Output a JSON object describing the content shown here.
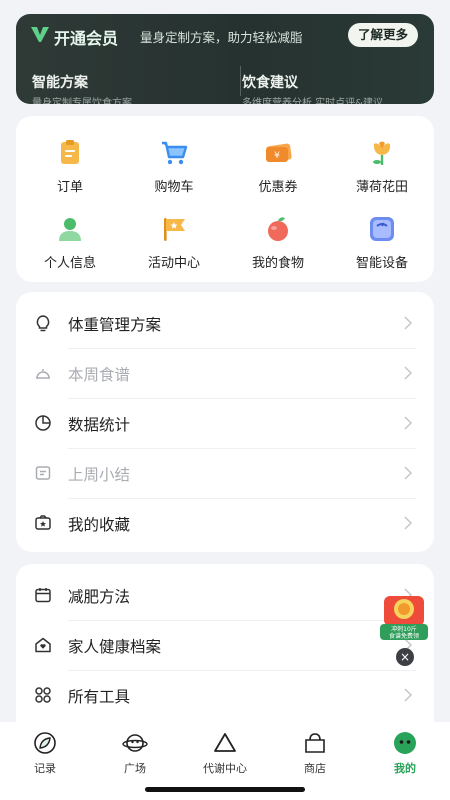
{
  "vip": {
    "title": "开通会员",
    "slogan": "量身定制方案，助力轻松减脂",
    "more_label": "了解更多",
    "left_title": "智能方案",
    "left_sub": "量身定制专属饮食方案",
    "right_title": "饮食建议",
    "right_sub": "多维度营养分析 实时点评&建议"
  },
  "grid": [
    {
      "label": "订单",
      "icon": "order-icon"
    },
    {
      "label": "购物车",
      "icon": "cart-icon"
    },
    {
      "label": "优惠券",
      "icon": "coupon-icon"
    },
    {
      "label": "薄荷花田",
      "icon": "flower-icon"
    },
    {
      "label": "个人信息",
      "icon": "person-icon"
    },
    {
      "label": "活动中心",
      "icon": "flag-icon"
    },
    {
      "label": "我的食物",
      "icon": "apple-icon"
    },
    {
      "label": "智能设备",
      "icon": "scale-icon"
    }
  ],
  "menu1": [
    {
      "label": "体重管理方案",
      "icon": "bulb-icon",
      "dim": false
    },
    {
      "label": "本周食谱",
      "icon": "cloche-icon",
      "dim": true
    },
    {
      "label": "数据统计",
      "icon": "pie-chart-icon",
      "dim": false
    },
    {
      "label": "上周小结",
      "icon": "summary-icon",
      "dim": true
    },
    {
      "label": "我的收藏",
      "icon": "favorite-icon",
      "dim": false
    }
  ],
  "menu2": [
    {
      "label": "减肥方法",
      "icon": "calendar-icon"
    },
    {
      "label": "家人健康档案",
      "icon": "family-home-icon"
    },
    {
      "label": "所有工具",
      "icon": "tools-grid-icon"
    }
  ],
  "promo": {
    "text_line1": "冲刺10斤",
    "text_line2": "食谱免费领"
  },
  "tabs": [
    {
      "label": "记录",
      "icon": "record-leaf-icon",
      "active": false
    },
    {
      "label": "广场",
      "icon": "planet-icon",
      "active": false
    },
    {
      "label": "代谢中心",
      "icon": "triangle-icon",
      "active": false
    },
    {
      "label": "商店",
      "icon": "shop-icon",
      "active": false
    },
    {
      "label": "我的",
      "icon": "mine-icon",
      "active": true
    }
  ],
  "colors": {
    "accent": "#2aa35a",
    "vip_bg": "#2a3532",
    "page_bg": "#f2f3f7"
  }
}
